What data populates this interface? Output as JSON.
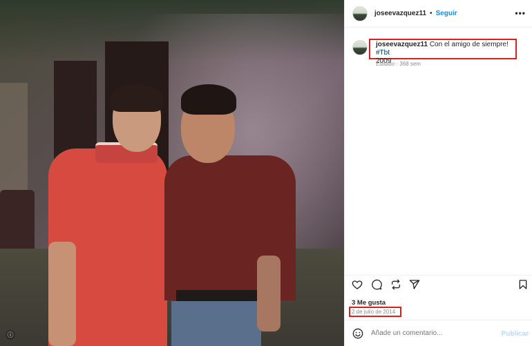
{
  "post": {
    "photo_alt": "Dos hombres posando juntos",
    "badge_glyph": "ⓘ"
  },
  "header": {
    "username": "joseevazquez11",
    "separator": "•",
    "follow_label": "Seguir",
    "more_icon": "more-options-icon",
    "more_glyph": "•••"
  },
  "caption": {
    "username": "joseevazquez11",
    "text": " Con el amigo de siempre! ",
    "hashtag": "#Tbt",
    "year": "2009",
    "meta": "Editado · 368 sem"
  },
  "actions": {
    "icons": [
      "heart-icon",
      "comment-icon",
      "repost-icon",
      "share-icon",
      "bookmark-icon"
    ]
  },
  "likes": "3 Me gusta",
  "date": "2 de julio de 2014",
  "comment": {
    "placeholder": "Añade un comentario...",
    "publish_label": "Publicar"
  },
  "colors": {
    "accent": "#0095f6",
    "highlight_box": "#d9201c",
    "hashtag": "#00376b",
    "muted": "#8e8e8e"
  }
}
